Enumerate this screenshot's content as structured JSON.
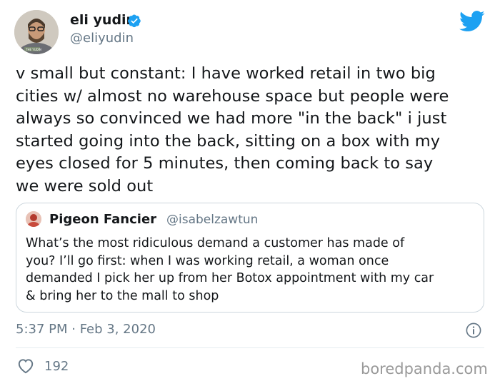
{
  "author": {
    "name": "eli yudin",
    "handle": "@eliyudin",
    "verified": true,
    "avatar_badge": "THE YUDIN"
  },
  "tweet_text": "v small but constant: I have worked retail in two big\ncities w/ almost no warehouse space but people were\nalways so convinced we had more \"in the back\" i just\nstarted going into the back, sitting on a box with my\neyes closed for 5 minutes, then coming back to say\nwe were sold out",
  "quoted_tweet": {
    "name": "Pigeon Fancier",
    "handle": "@isabelzawtun",
    "text": "What’s the most ridiculous demand a customer has made of\nyou? I’ll go first: when I was working retail, a woman once\ndemanded I pick her up from her Botox appointment with my car\n& bring her to the mall to shop"
  },
  "timestamp": "5:37 PM · Feb 3, 2020",
  "likes": "192",
  "watermark": "boredpanda.com",
  "icons": {
    "platform": "twitter-bird-icon",
    "verified": "verified-badge-icon",
    "info": "info-icon",
    "like": "heart-icon"
  },
  "colors": {
    "twitter_blue": "#1da1f2",
    "secondary_text": "#657786",
    "primary_text": "#14171a",
    "border": "#ccd6dd"
  }
}
